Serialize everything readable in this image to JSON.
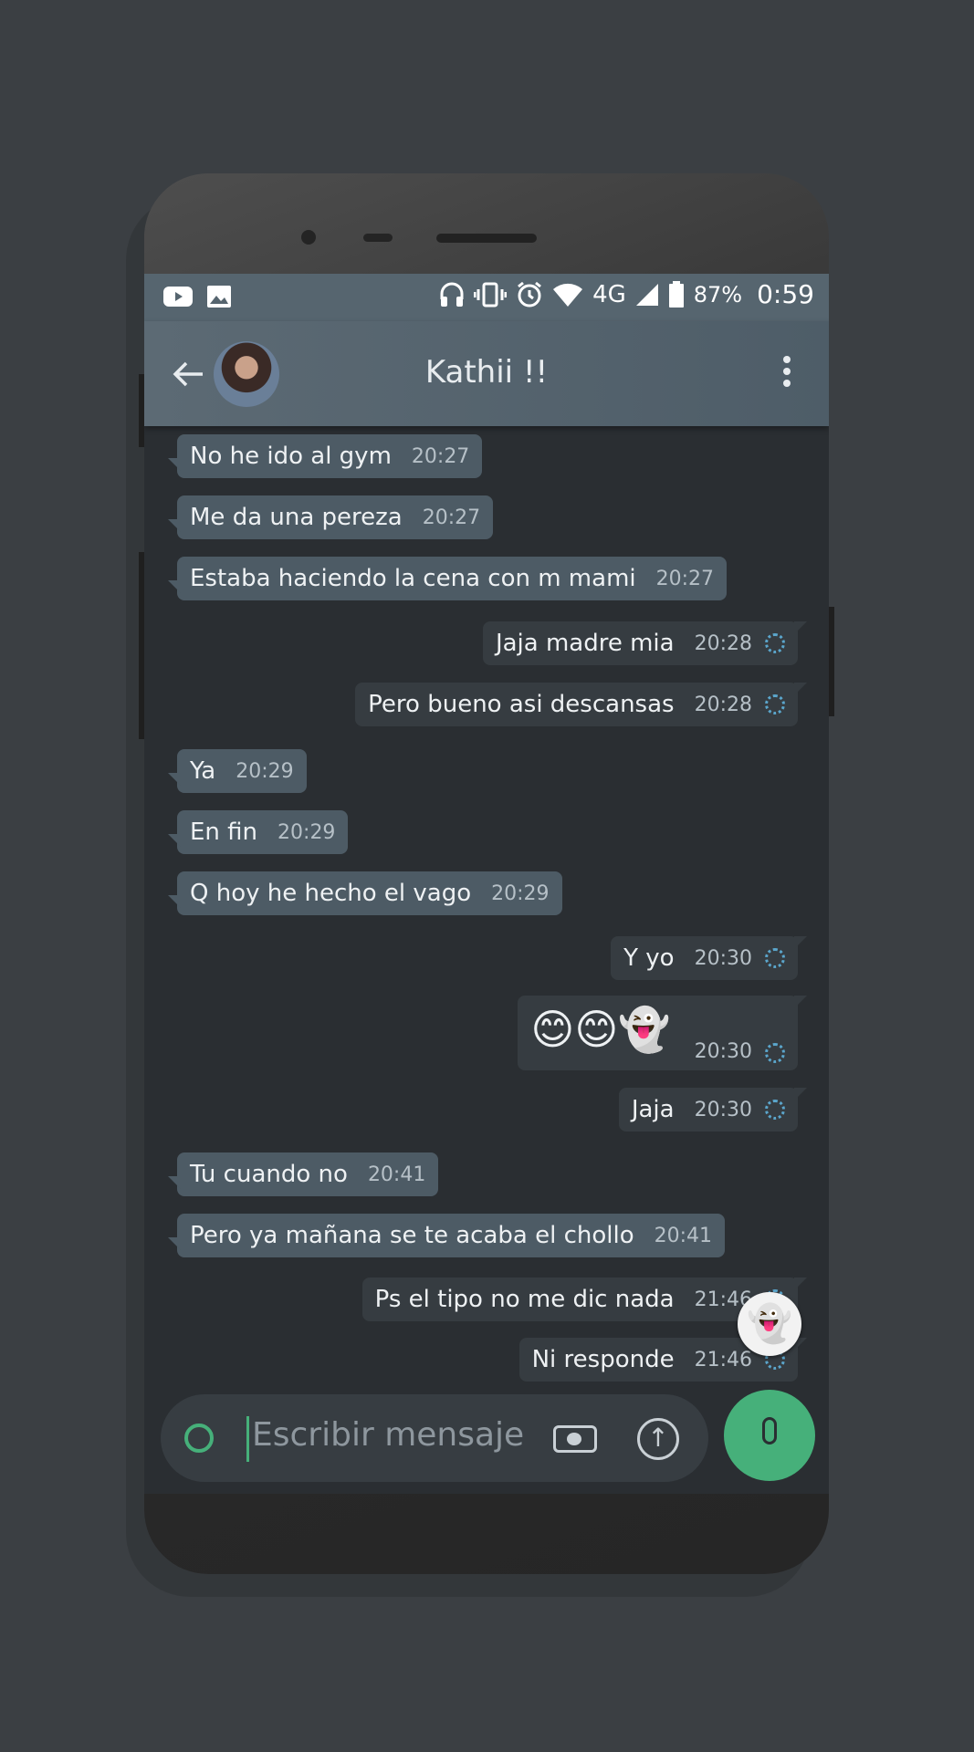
{
  "statusbar": {
    "battery": "87%",
    "time": "0:59",
    "network": "4G"
  },
  "header": {
    "contact_name": "Kathii !!"
  },
  "messages": [
    {
      "text": "No he ido al gym",
      "time": "20:27",
      "dir": "in"
    },
    {
      "text": "Me da una pereza",
      "time": "20:27",
      "dir": "in"
    },
    {
      "text": "Estaba haciendo la cena con m mami",
      "time": "20:27",
      "dir": "in"
    },
    {
      "text": "Jaja madre mia",
      "time": "20:28",
      "dir": "out"
    },
    {
      "text": "Pero bueno asi descansas",
      "time": "20:28",
      "dir": "out"
    },
    {
      "text": "Ya",
      "time": "20:29",
      "dir": "in"
    },
    {
      "text": "En fin",
      "time": "20:29",
      "dir": "in"
    },
    {
      "text": "Q hoy he hecho el vago",
      "time": "20:29",
      "dir": "in"
    },
    {
      "text": "Y yo",
      "time": "20:30",
      "dir": "out"
    },
    {
      "text": "😊😊👻",
      "time": "20:30",
      "dir": "out"
    },
    {
      "text": "Jaja",
      "time": "20:30",
      "dir": "out"
    },
    {
      "text": "Tu cuando no",
      "time": "20:41",
      "dir": "in"
    },
    {
      "text": "Pero ya mañana se te acaba el chollo",
      "time": "20:41",
      "dir": "in"
    },
    {
      "text": "Ps el tipo no me dic nada",
      "time": "21:46",
      "dir": "out"
    },
    {
      "text": "Ni responde",
      "time": "21:46",
      "dir": "out"
    }
  ],
  "composer": {
    "placeholder": "Escribir mensaje"
  },
  "colors": {
    "accent": "#46b07a",
    "appbar": "#56656f",
    "incoming_bubble": "#4d5b65",
    "outgoing_bubble": "#363c41",
    "pending_tick": "#5ba6cc"
  }
}
